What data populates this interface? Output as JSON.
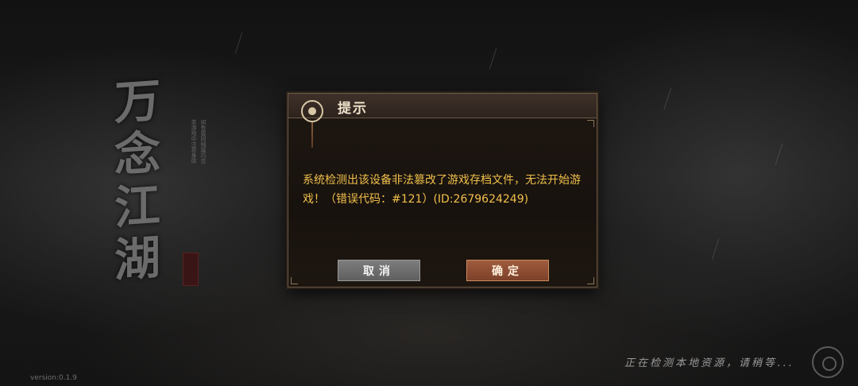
{
  "game": {
    "logo_text": "万念江湖",
    "logo_subtitle_lines": [
      "本游戏中注意身体",
      "如有雷同纯属巧合"
    ]
  },
  "dialog": {
    "title": "提示",
    "message": "系统检测出该设备非法篡改了游戏存档文件，无法开始游戏！（错误代码：#121）(ID:2679624249)",
    "cancel_label": "取消",
    "confirm_label": "确定"
  },
  "status": {
    "loading_text": "正在检测本地资源，请稍等...",
    "version": "version:0.1.9"
  },
  "colors": {
    "message": "#f0c04a",
    "confirm_button": "#8c4a30",
    "cancel_button": "#6e6e6e",
    "dialog_border": "#6b5a45"
  }
}
